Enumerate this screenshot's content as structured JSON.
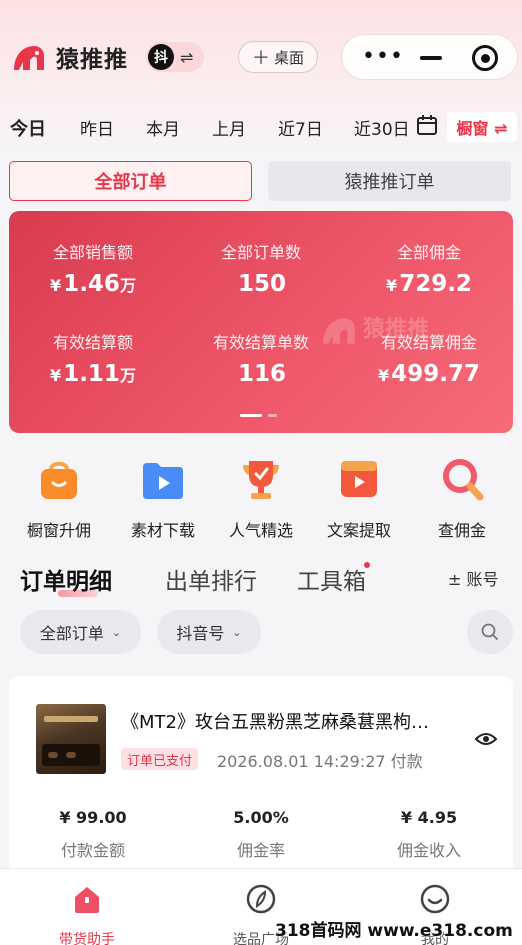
{
  "header": {
    "brand": "猿推推",
    "platform_icon": "抖",
    "swap_icon": "⇌",
    "desktop_label": "桌面",
    "desktop_plus": "＋"
  },
  "date_tabs": [
    "今日",
    "昨日",
    "本月",
    "上月",
    "近7日",
    "近30日"
  ],
  "shop_button": "橱窗 ⇌",
  "order_switch": {
    "all": "全部订单",
    "ytt": "猿推推订单"
  },
  "stats": {
    "watermark": "猿推推",
    "items": [
      {
        "label": "全部销售额",
        "yen": "¥",
        "value": "1.46",
        "unit": "万"
      },
      {
        "label": "全部订单数",
        "yen": "",
        "value": "150",
        "unit": ""
      },
      {
        "label": "全部佣金",
        "yen": "¥",
        "value": "729.2",
        "unit": ""
      },
      {
        "label": "有效结算额",
        "yen": "¥",
        "value": "1.11",
        "unit": "万"
      },
      {
        "label": "有效结算单数",
        "yen": "",
        "value": "116",
        "unit": ""
      },
      {
        "label": "有效结算佣金",
        "yen": "¥",
        "value": "499.77",
        "unit": ""
      }
    ]
  },
  "tools": [
    {
      "label": "橱窗升佣",
      "icon": "shopping-bag-icon"
    },
    {
      "label": "素材下载",
      "icon": "folder-play-icon"
    },
    {
      "label": "人气精选",
      "icon": "trophy-icon"
    },
    {
      "label": "文案提取",
      "icon": "video-text-icon"
    },
    {
      "label": "查佣金",
      "icon": "magnifier-icon"
    }
  ],
  "section_tabs": [
    "订单明细",
    "出单排行",
    "工具箱"
  ],
  "account_label": "± 账号",
  "filters": {
    "order_filter": "全部订单",
    "account_filter": "抖音号",
    "caret": "⌄"
  },
  "order": {
    "title": "《MT2》玫台五黑粉黑芝麻桑葚黑枸…",
    "status": "订单已支付",
    "time": "2026.08.01 14:29:27 付款",
    "metrics": [
      {
        "value": "¥ 99.00",
        "label": "付款金额"
      },
      {
        "value": "5.00%",
        "label": "佣金率"
      },
      {
        "value": "¥ 4.95",
        "label": "佣金收入"
      }
    ]
  },
  "tabbar": [
    {
      "label": "带货助手",
      "icon": "home-icon"
    },
    {
      "label": "选品广场",
      "icon": "compass-icon"
    },
    {
      "label": "我的",
      "icon": "smile-icon"
    }
  ],
  "site_watermark": "318首码网 www.e318.com",
  "colors": {
    "accent": "#e8374a",
    "card_start": "#d93b4f",
    "card_end": "#f66b79"
  }
}
